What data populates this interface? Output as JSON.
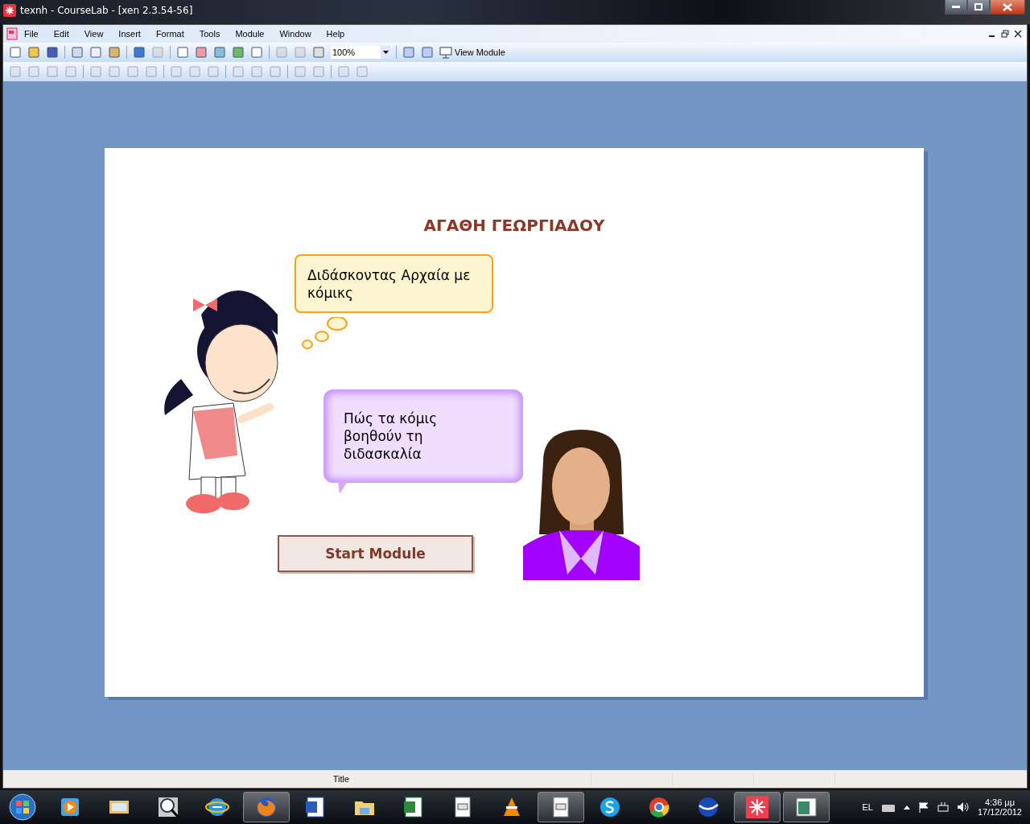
{
  "window": {
    "title": "texnh - CourseLab - [xen 2.3.54-56]"
  },
  "menu": [
    "File",
    "Edit",
    "View",
    "Insert",
    "Format",
    "Tools",
    "Module",
    "Window",
    "Help"
  ],
  "toolbar": {
    "zoom": "100%",
    "view_module": "View Module"
  },
  "slide": {
    "title": "ΑΓΑΘΗ ΓΕΩΡΓΙΑΔΟΥ",
    "bubbles": [
      {
        "kind": "thought",
        "text": "Διδάσκοντας Αρχαία με κόμικς"
      },
      {
        "kind": "speech",
        "text": "Πώς τα κόμις βοηθούν τη διδασκαλία"
      }
    ],
    "button": "Start Module"
  },
  "status_bar": {
    "text": "Title"
  },
  "taskbar": {
    "apps": [
      {
        "kind": "media",
        "selected": false
      },
      {
        "kind": "mail",
        "selected": false
      },
      {
        "kind": "viewer",
        "selected": false
      },
      {
        "kind": "browser-e",
        "selected": false
      },
      {
        "kind": "firefox",
        "selected": true
      },
      {
        "kind": "word",
        "selected": false
      },
      {
        "kind": "folder",
        "selected": false
      },
      {
        "kind": "excel",
        "selected": false
      },
      {
        "kind": "page",
        "selected": false
      },
      {
        "kind": "cone",
        "selected": false
      },
      {
        "kind": "page",
        "selected": true
      },
      {
        "kind": "skype",
        "selected": false
      },
      {
        "kind": "chrome",
        "selected": false
      },
      {
        "kind": "globe",
        "selected": false
      },
      {
        "kind": "courselab",
        "selected": true
      },
      {
        "kind": "window",
        "selected": true
      }
    ],
    "language": "EL",
    "time": "4:36 μμ",
    "date": "17/12/2012"
  }
}
